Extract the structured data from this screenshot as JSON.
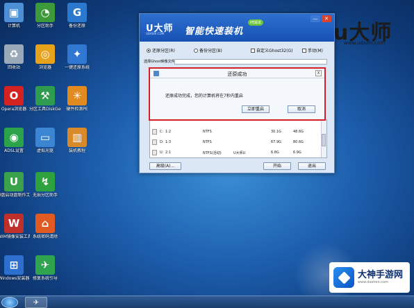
{
  "desktop": {
    "icons": [
      {
        "label": "计算机",
        "icon": "computer-icon",
        "color": "#4d8fd6",
        "glyph": "▣"
      },
      {
        "label": "回收站",
        "icon": "recycle-bin-icon",
        "color": "#9aa9b8",
        "glyph": "♻"
      },
      {
        "label": "Opera浏览器",
        "icon": "opera-icon",
        "color": "#d3221f",
        "glyph": "O"
      },
      {
        "label": "ADSL设置",
        "icon": "network-icon",
        "color": "#2aa34a",
        "glyph": "◉"
      },
      {
        "label": "U盘启动盘制作工具",
        "icon": "usb-tool-icon",
        "color": "#3aa24a",
        "glyph": "U"
      },
      {
        "label": "WIM镜像安装工具",
        "icon": "wim-icon",
        "color": "#c0302b",
        "glyph": "W"
      },
      {
        "label": "Windows安装器",
        "icon": "windows-installer-icon",
        "color": "#2c6fcf",
        "glyph": "⊞"
      },
      {
        "label": "分区助手",
        "icon": "partition-assistant-icon",
        "color": "#3d9a3a",
        "glyph": "◔"
      },
      {
        "label": "浏览器",
        "icon": "browser-icon",
        "color": "#e6a21a",
        "glyph": "◎"
      },
      {
        "label": "分区工具DiskGenius",
        "icon": "diskgenius-icon",
        "color": "#2f9b4e",
        "glyph": "⚒"
      },
      {
        "label": "虚拟光驱",
        "icon": "virtual-drive-icon",
        "color": "#3b86d3",
        "glyph": "▭"
      },
      {
        "label": "无损分区助手",
        "icon": "lossless-partition-icon",
        "color": "#2ea23f",
        "glyph": "↯"
      },
      {
        "label": "系统密码清除",
        "icon": "password-clear-icon",
        "color": "#e05a22",
        "glyph": "⌂"
      },
      {
        "label": "修复系统引导",
        "icon": "boot-repair-icon",
        "color": "#2fa34d",
        "glyph": "✈"
      },
      {
        "label": "备份还原",
        "icon": "backup-restore-icon",
        "color": "#2b78cf",
        "glyph": "G"
      },
      {
        "label": "一键还原系统",
        "icon": "one-key-restore-icon",
        "color": "#2f77d1",
        "glyph": "✦"
      },
      {
        "label": "硬件检测PE",
        "icon": "hardware-detect-icon",
        "color": "#e08a20",
        "glyph": "✳"
      },
      {
        "label": "装机教程",
        "icon": "tutorial-icon",
        "color": "#d88a2a",
        "glyph": "▥"
      }
    ]
  },
  "watermark": {
    "brand": "u大师",
    "url": "www.udashi.com"
  },
  "corner_brand": {
    "name": "大神手游网",
    "url": "www.dashen.com"
  },
  "app": {
    "logo": "U大师",
    "logo_sub": "UDASHI.COM",
    "title": "智能快速装机",
    "badge": "PE版本",
    "minimize": "—",
    "close": "✕",
    "options": {
      "restore_label": "还原分区(R)",
      "backup_label": "备份分区(B)",
      "custom_ghost_label": "自定义Ghost32(G)",
      "manual_label": "手动(M)",
      "ghost_select_value": ""
    },
    "file_row_label": "选择Ghost映像文件",
    "partitions": [
      {
        "drive": "C:",
        "index": "1:2",
        "fs": "NTFS",
        "type": "",
        "used": "30.1G",
        "total": "48.6G"
      },
      {
        "drive": "D:",
        "index": "1:3",
        "fs": "NTFS",
        "type": "",
        "used": "67.9G",
        "total": "80.6G"
      },
      {
        "drive": "U:",
        "index": "2:1",
        "fs": "NTFS(活动)",
        "type": "U大师U",
        "used": "6.8G",
        "total": "6.9G"
      }
    ],
    "advanced_label": "高级(A)...",
    "start_label": "开始",
    "exit_label": "退出"
  },
  "dialog": {
    "title": "还原成功",
    "close": "X",
    "message": "还原成功完成，您的计算机将在7秒内重启",
    "restart_label": "立即重启",
    "cancel_label": "取消"
  },
  "taskbar": {
    "app_glyph": "✈"
  }
}
